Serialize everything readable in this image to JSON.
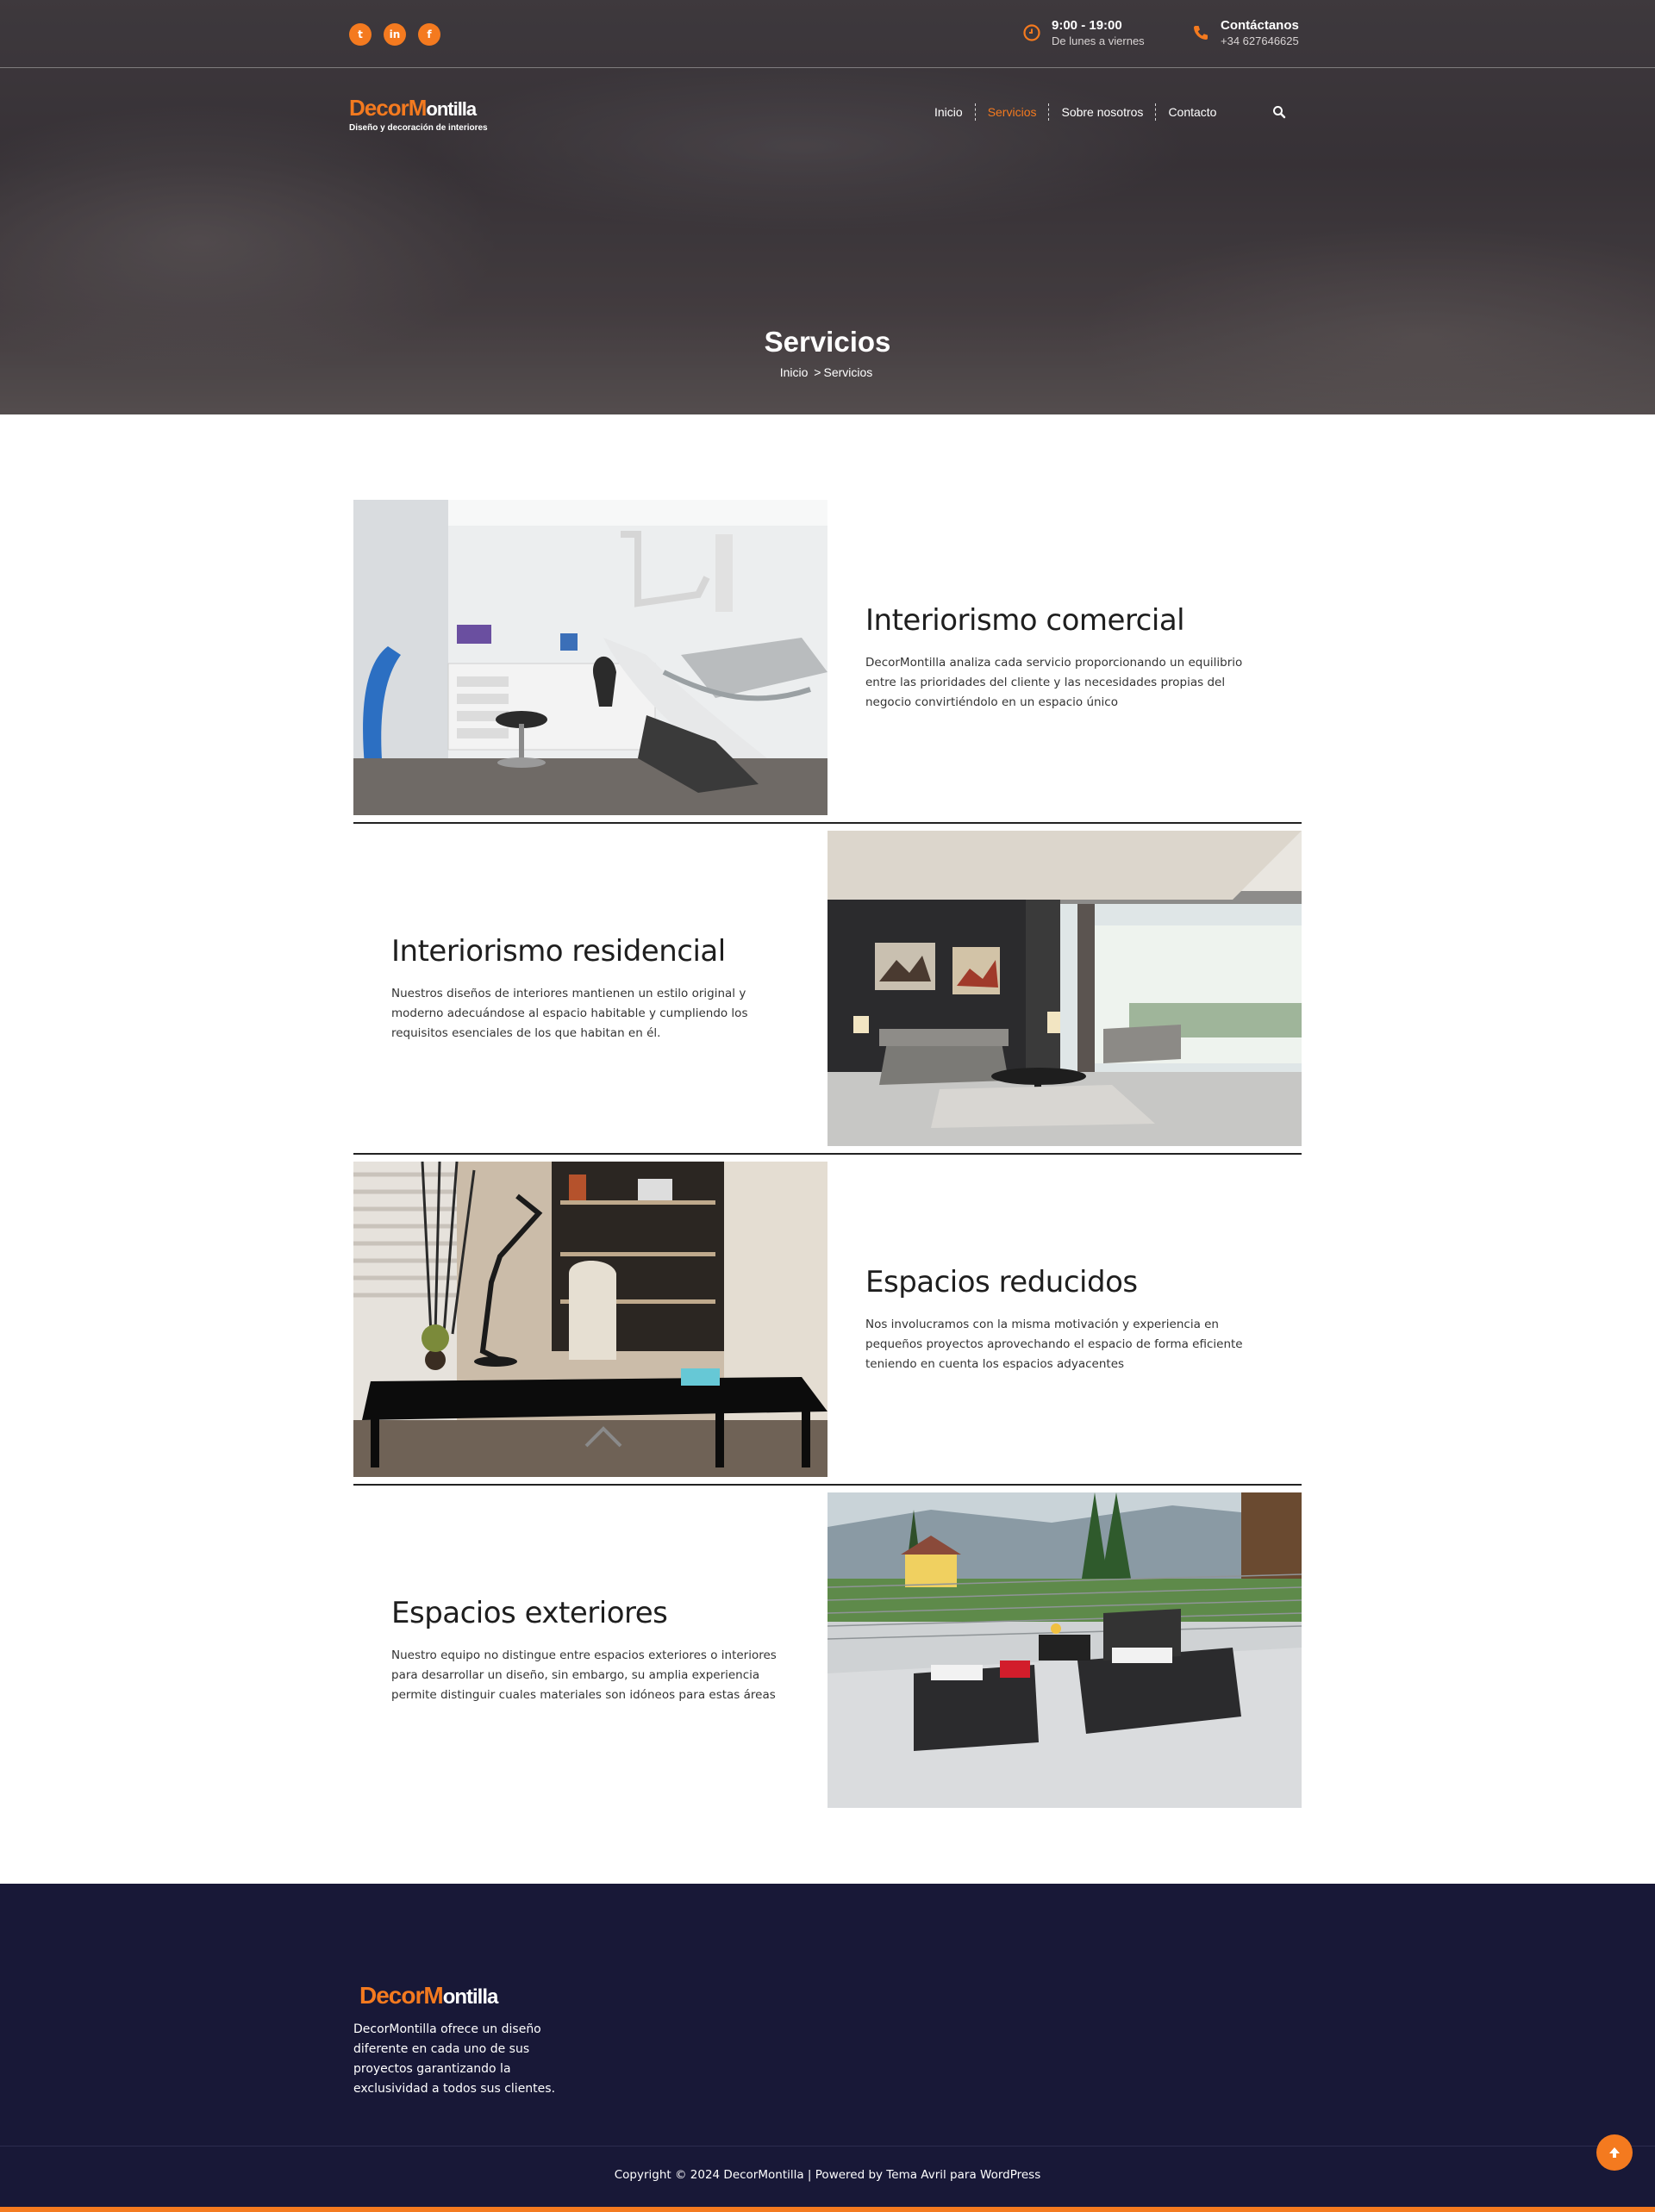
{
  "colors": {
    "accent": "#f47a1f",
    "footer_bg": "#181837",
    "hero_overlay": "#3f3a3e"
  },
  "social": [
    {
      "icon": "twitter-icon",
      "glyph": "t"
    },
    {
      "icon": "linkedin-icon",
      "glyph": "in"
    },
    {
      "icon": "facebook-icon",
      "glyph": "f"
    }
  ],
  "topbar": {
    "hours": {
      "title": "9:00 - 19:00",
      "subtitle": "De lunes a viernes",
      "icon": "clock-icon"
    },
    "contact": {
      "title": "Contáctanos",
      "subtitle": "+34 627646625",
      "icon": "phone-icon"
    }
  },
  "logo": {
    "part1": "Decor",
    "part2": "M",
    "part3": "ontilla",
    "tagline": "Diseño y decoración de interiores"
  },
  "nav": {
    "items": [
      "Inicio",
      "Servicios",
      "Sobre nosotros",
      "Contacto"
    ],
    "active": "Servicios",
    "search_icon": "search-icon"
  },
  "hero": {
    "title": "Servicios",
    "breadcrumb": {
      "home": "Inicio",
      "separator": ">",
      "current": "Servicios"
    }
  },
  "services": [
    {
      "title": "Interiorismo comercial",
      "text": "DecorMontilla analiza cada servicio proporcionando un equilibrio entre las prioridades del cliente y las necesidades propias del negocio convirtiéndolo en un espacio único"
    },
    {
      "title": "Interiorismo residencial",
      "text": "Nuestros diseños de interiores mantienen un estilo original y moderno adecuándose al espacio habitable y cumpliendo los requisitos esenciales de los que habitan en él."
    },
    {
      "title": "Espacios reducidos",
      "text": "Nos involucramos con la misma motivación y experiencia en pequeños proyectos aprovechando el espacio de forma eficiente teniendo en cuenta los espacios adyacentes"
    },
    {
      "title": "Espacios exteriores",
      "text": "Nuestro equipo no distingue entre espacios exteriores o interiores para desarrollar un diseño, sin embargo, su amplia experiencia permite distinguir cuales materiales son idóneos para estas áreas"
    }
  ],
  "footer": {
    "logo": {
      "part1": "Decor",
      "part2": "M",
      "part3": "ontilla"
    },
    "description": "DecorMontilla ofrece un diseño diferente en cada uno de sus proyectos garantizando la exclusividad a todos sus clientes.",
    "copyright": "Copyright © 2024 DecorMontilla | Powered by Tema Avril para WordPress",
    "totop_icon": "arrow-up-icon"
  }
}
